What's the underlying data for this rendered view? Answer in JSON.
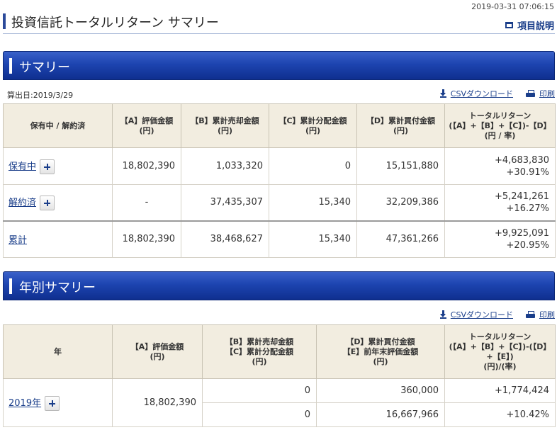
{
  "timestamp": "2019-03-31 07:06:15",
  "page": {
    "title": "投資信託トータルリターン サマリー",
    "help_label": "項目説明"
  },
  "summary": {
    "banner": "サマリー",
    "calc_date": "算出日:2019/3/29",
    "csv_label": "CSVダウンロード",
    "print_label": "印刷",
    "headers": {
      "status": "保有中 / 解約済",
      "a_l1": "【A】評価金額",
      "a_l2": "(円)",
      "b_l1": "【B】累計売却金額",
      "b_l2": "(円)",
      "c_l1": "【C】累計分配金額",
      "c_l2": "(円)",
      "d_l1": "【D】累計買付金額",
      "d_l2": "(円)",
      "r_l1": "トータルリターン",
      "r_l2": "(【A】+【B】+【C】)-【D】",
      "r_l3": "(円 / 率)"
    },
    "rows": [
      {
        "label": "保有中",
        "a": "18,802,390",
        "b": "1,033,320",
        "c": "0",
        "d": "15,151,880",
        "ret_amount": "+4,683,830",
        "ret_rate": "+30.91%"
      },
      {
        "label": "解約済",
        "a": "-",
        "b": "37,435,307",
        "c": "15,340",
        "d": "32,209,386",
        "ret_amount": "+5,241,261",
        "ret_rate": "+16.27%"
      },
      {
        "label": "累計",
        "a": "18,802,390",
        "b": "38,468,627",
        "c": "15,340",
        "d": "47,361,266",
        "ret_amount": "+9,925,091",
        "ret_rate": "+20.95%"
      }
    ]
  },
  "annual": {
    "banner": "年別サマリー",
    "csv_label": "CSVダウンロード",
    "print_label": "印刷",
    "headers": {
      "year": "年",
      "a_l1": "【A】評価金額",
      "a_l2": "(円)",
      "bc_l1": "【B】累計売却金額",
      "bc_l2": "【C】累計分配金額",
      "bc_l3": "(円)",
      "de_l1": "【D】累計買付金額",
      "de_l2": "【E】前年末評価金額",
      "de_l3": "(円)",
      "r_l1": "トータルリターン",
      "r_l2": "(【A】+【B】+【C】)-(【D】",
      "r_l3": "+【E】)",
      "r_l4": "(円)/(率)"
    },
    "rows": [
      {
        "year": "2019年",
        "a": "18,802,390",
        "b": "0",
        "c": "0",
        "d": "360,000",
        "e": "16,667,966",
        "ret_amount": "+1,774,424",
        "ret_rate": "+10.42%"
      }
    ]
  },
  "colors": {
    "banner": "#1d44b0",
    "link": "#1a3e8a",
    "positive": "#e0211d",
    "header_bg": "#f2ede0"
  }
}
